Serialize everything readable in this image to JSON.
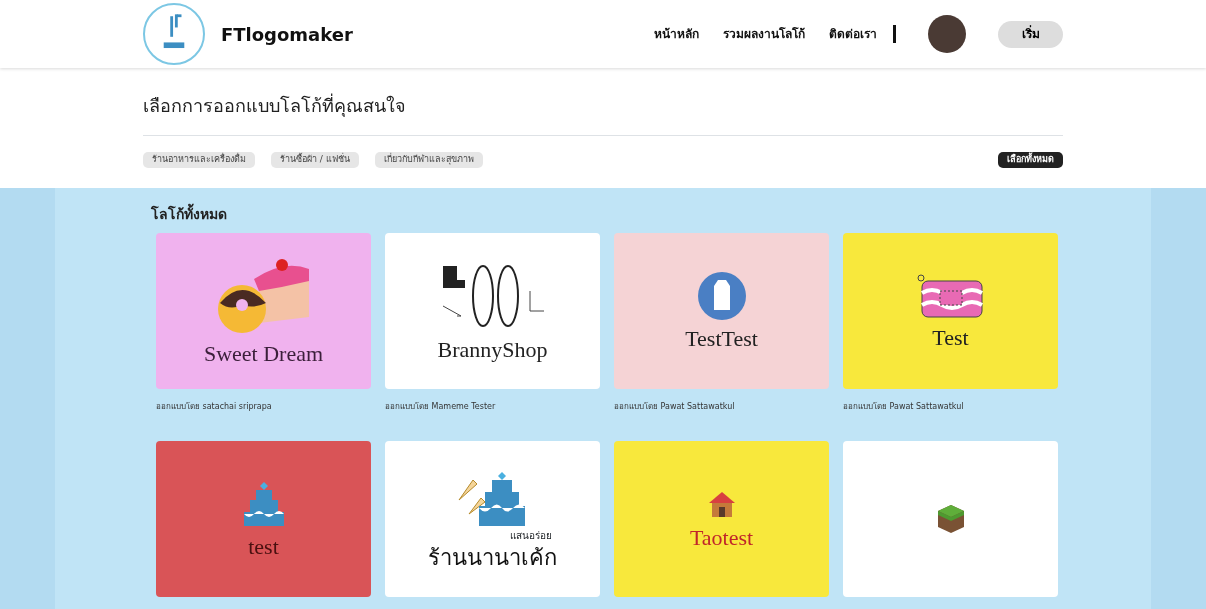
{
  "navbar": {
    "brand": "FTlogomaker",
    "links": [
      "หน้าหลัก",
      "รวมผลงานโลโก้",
      "ติดต่อเรา"
    ],
    "button": "เริ่ม"
  },
  "header": {
    "title": "เลือกการออกแบบโลโก้ที่คุณสนใจ",
    "filters": [
      {
        "label": "ร้านอาหารและเครื่องดื่ม",
        "selected": false
      },
      {
        "label": "ร้านซื้อผ้า / แฟชั่น",
        "selected": false
      },
      {
        "label": "เกี่ยวกับกีฬาและสุขภาพ",
        "selected": false
      },
      {
        "label": "เลือกทั้งหมด",
        "selected": true
      }
    ]
  },
  "gallery": {
    "title": "โลโก้ทั้งหมด",
    "logos": [
      {
        "kind": "donut-cake",
        "color": "#f0b2ee",
        "name": "Sweet Dream",
        "designer": "ออกแบบโดย satachai sriprapa"
      },
      {
        "kind": "shoes",
        "color": "#ffffff",
        "name": "BrannyShop",
        "designer": "ออกแบบโดย Mameme Tester"
      },
      {
        "kind": "milk",
        "color": "#f5d3d5",
        "name": "TestTest",
        "designer": "ออกแบบโดย Pawat Sattawatkul"
      },
      {
        "kind": "pouch",
        "color": "#f8e83c",
        "name": "Test",
        "designer": "ออกแบบโดย Pawat Sattawatkul"
      },
      {
        "kind": "cake",
        "color": "#d95457",
        "name": "test"
      },
      {
        "kind": "cake-carrots",
        "color": "#ffffff",
        "name": "ร้านนานาเค้ก",
        "tagline": "แสนอร่อย"
      },
      {
        "kind": "house",
        "color": "#f8e83c",
        "name": "Taotest"
      },
      {
        "kind": "grass-block",
        "color": "#ffffff"
      }
    ]
  }
}
